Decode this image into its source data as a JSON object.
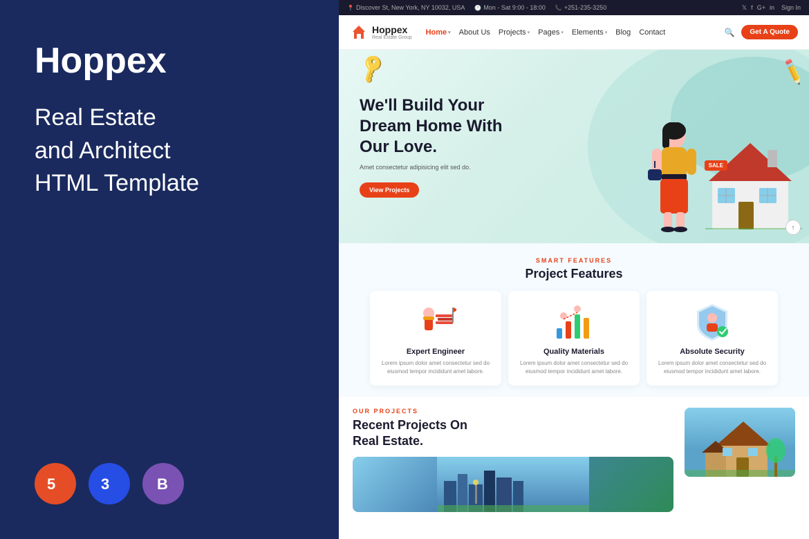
{
  "left": {
    "brand": "Hoppex",
    "description_line1": "Real Estate",
    "description_line2": "and Architect",
    "description_line3": "HTML Template",
    "badges": [
      {
        "id": "html",
        "label": "HTML5",
        "symbol": "5"
      },
      {
        "id": "css",
        "label": "CSS3",
        "symbol": "3"
      },
      {
        "id": "bootstrap",
        "label": "Bootstrap",
        "symbol": "B"
      }
    ]
  },
  "topbar": {
    "address": "Discover St, New York, NY 10032, USA",
    "hours": "Mon - Sat 9:00 - 18:00",
    "phone": "+251-235-3250",
    "social": [
      "twitter",
      "facebook",
      "google-plus",
      "linkedin"
    ],
    "sign_in": "Sign In"
  },
  "navbar": {
    "logo_name": "Hoppex",
    "logo_sub": "Real Estate Group",
    "nav_items": [
      {
        "label": "Home",
        "active": true,
        "has_dropdown": true
      },
      {
        "label": "About Us",
        "active": false,
        "has_dropdown": false
      },
      {
        "label": "Projects",
        "active": false,
        "has_dropdown": true
      },
      {
        "label": "Pages",
        "active": false,
        "has_dropdown": true
      },
      {
        "label": "Elements",
        "active": false,
        "has_dropdown": true
      },
      {
        "label": "Blog",
        "active": false,
        "has_dropdown": false
      },
      {
        "label": "Contact",
        "active": false,
        "has_dropdown": false
      }
    ],
    "quote_btn": "Get A Quote"
  },
  "hero": {
    "title_line1": "We'll Build Your",
    "title_line2": "Dream Home With",
    "title_line3": "Our Love.",
    "subtitle": "Amet consectetur adipisicing elit sed do.",
    "cta_btn": "View Projects"
  },
  "features": {
    "section_label": "SMART FEATURES",
    "section_title": "Project Features",
    "items": [
      {
        "name": "Expert Engineer",
        "icon": "👷",
        "description": "Lorem ipsum dolor amet consectetur sed do eiusmod tempor incididunt amet labore."
      },
      {
        "name": "Quality Materials",
        "icon": "📊",
        "description": "Lorem ipsum dolor amet consectetur sed do eiusmod tempor incididunt amet labore."
      },
      {
        "name": "Absolute Security",
        "icon": "🛡️",
        "description": "Lorem ipsum dolor amet consectetur sed do eiusmod tempor incididunt amet labore."
      }
    ]
  },
  "projects": {
    "section_label": "OUR PROJECTS",
    "title_line1": "Recent Projects On",
    "title_line2": "Real Estate."
  }
}
